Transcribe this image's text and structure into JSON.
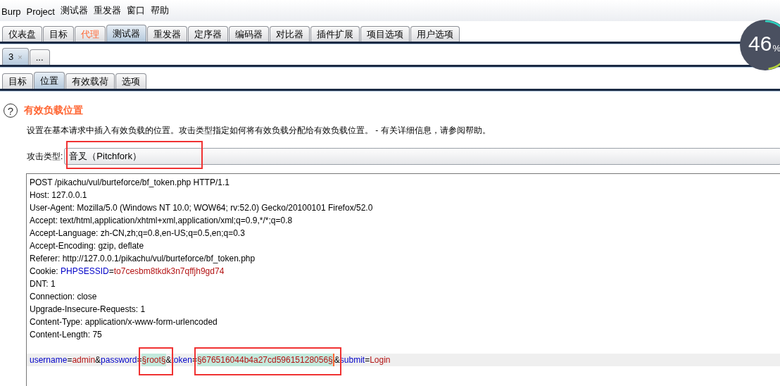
{
  "menu_bar": [
    "Burp",
    "Project",
    "测试器",
    "重发器",
    "窗口",
    "帮助"
  ],
  "main_tabs": [
    {
      "label": "仪表盘",
      "selected": false,
      "highlighted": false
    },
    {
      "label": "目标",
      "selected": false,
      "highlighted": false
    },
    {
      "label": "代理",
      "selected": false,
      "highlighted": true
    },
    {
      "label": "测试器",
      "selected": true,
      "highlighted": false
    },
    {
      "label": "重发器",
      "selected": false,
      "highlighted": false
    },
    {
      "label": "定序器",
      "selected": false,
      "highlighted": false
    },
    {
      "label": "编码器",
      "selected": false,
      "highlighted": false
    },
    {
      "label": "对比器",
      "selected": false,
      "highlighted": false
    },
    {
      "label": "插件扩展",
      "selected": false,
      "highlighted": false
    },
    {
      "label": "项目选项",
      "selected": false,
      "highlighted": false
    },
    {
      "label": "用户选项",
      "selected": false,
      "highlighted": false
    }
  ],
  "attack_tabs": [
    {
      "label": "3",
      "close": "×",
      "selected": true
    },
    {
      "label": "...",
      "selected": false
    }
  ],
  "sub_tabs": [
    {
      "label": "目标",
      "selected": false
    },
    {
      "label": "位置",
      "selected": true
    },
    {
      "label": "有效载荷",
      "selected": false
    },
    {
      "label": "选项",
      "selected": false
    }
  ],
  "section": {
    "help_icon": "?",
    "title": "有效负载位置",
    "description": "设置在基本请求中插入有效负载的位置。攻击类型指定如何将有效负载分配给有效负载位置。 - 有关详细信息，请参阅帮助。",
    "attack_type_label": "攻击类型:",
    "attack_type_value": "音叉（Pitchfork）",
    "attack_type_annotated": true
  },
  "request": [
    {
      "kind": "text",
      "segments": [
        {
          "kind": "plain",
          "text": "POST /pikachu/vul/burteforce/bf_token.php HTTP/1.1"
        }
      ]
    },
    {
      "kind": "text",
      "segments": [
        {
          "kind": "plain",
          "text": "Host: 127.0.0.1"
        }
      ]
    },
    {
      "kind": "text",
      "segments": [
        {
          "kind": "plain",
          "text": "User-Agent: Mozilla/5.0 (Windows NT 10.0; WOW64; rv:52.0) Gecko/20100101 Firefox/52.0"
        }
      ]
    },
    {
      "kind": "text",
      "segments": [
        {
          "kind": "plain",
          "text": "Accept: text/html,application/xhtml+xml,application/xml;q=0.9,*/*;q=0.8"
        }
      ]
    },
    {
      "kind": "text",
      "segments": [
        {
          "kind": "plain",
          "text": "Accept-Language: zh-CN,zh;q=0.8,en-US;q=0.5,en;q=0.3"
        }
      ]
    },
    {
      "kind": "text",
      "segments": [
        {
          "kind": "plain",
          "text": "Accept-Encoding: gzip, deflate"
        }
      ]
    },
    {
      "kind": "text",
      "segments": [
        {
          "kind": "plain",
          "text": "Referer: http://127.0.0.1/pikachu/vul/burteforce/bf_token.php"
        }
      ]
    },
    {
      "kind": "text",
      "segments": [
        {
          "kind": "plain",
          "text": "Cookie: "
        },
        {
          "kind": "name",
          "text": "PHPSESSID"
        },
        {
          "kind": "plain",
          "text": "="
        },
        {
          "kind": "value",
          "text": "to7cesbm8tkdk3n7qffjh9gd74"
        }
      ]
    },
    {
      "kind": "text",
      "segments": [
        {
          "kind": "plain",
          "text": "DNT: 1"
        }
      ]
    },
    {
      "kind": "text",
      "segments": [
        {
          "kind": "plain",
          "text": "Connection: close"
        }
      ]
    },
    {
      "kind": "text",
      "segments": [
        {
          "kind": "plain",
          "text": "Upgrade-Insecure-Requests: 1"
        }
      ]
    },
    {
      "kind": "text",
      "segments": [
        {
          "kind": "plain",
          "text": "Content-Type: application/x-www-form-urlencoded"
        }
      ]
    },
    {
      "kind": "text",
      "segments": [
        {
          "kind": "plain",
          "text": "Content-Length: 75"
        }
      ]
    },
    {
      "kind": "blank"
    },
    {
      "kind": "body",
      "segments": [
        {
          "kind": "name",
          "text": "username"
        },
        {
          "kind": "plain",
          "text": "="
        },
        {
          "kind": "value",
          "text": "admin"
        },
        {
          "kind": "plain",
          "text": "&"
        },
        {
          "kind": "name",
          "text": "password"
        },
        {
          "kind": "plain",
          "text": "="
        },
        {
          "kind": "payload",
          "text": "§root§",
          "annotated": true
        },
        {
          "kind": "plain",
          "text": "&"
        },
        {
          "kind": "name",
          "text": "token"
        },
        {
          "kind": "plain",
          "text": "="
        },
        {
          "kind": "payload",
          "text": "§676516044b4a27cd59615128056§",
          "annotated": true,
          "cursor": true
        },
        {
          "kind": "plain",
          "text": "&"
        },
        {
          "kind": "name",
          "text": "submit"
        },
        {
          "kind": "plain",
          "text": "="
        },
        {
          "kind": "value",
          "text": "Login"
        }
      ]
    }
  ],
  "gauge": {
    "value": "46",
    "unit": "%"
  }
}
